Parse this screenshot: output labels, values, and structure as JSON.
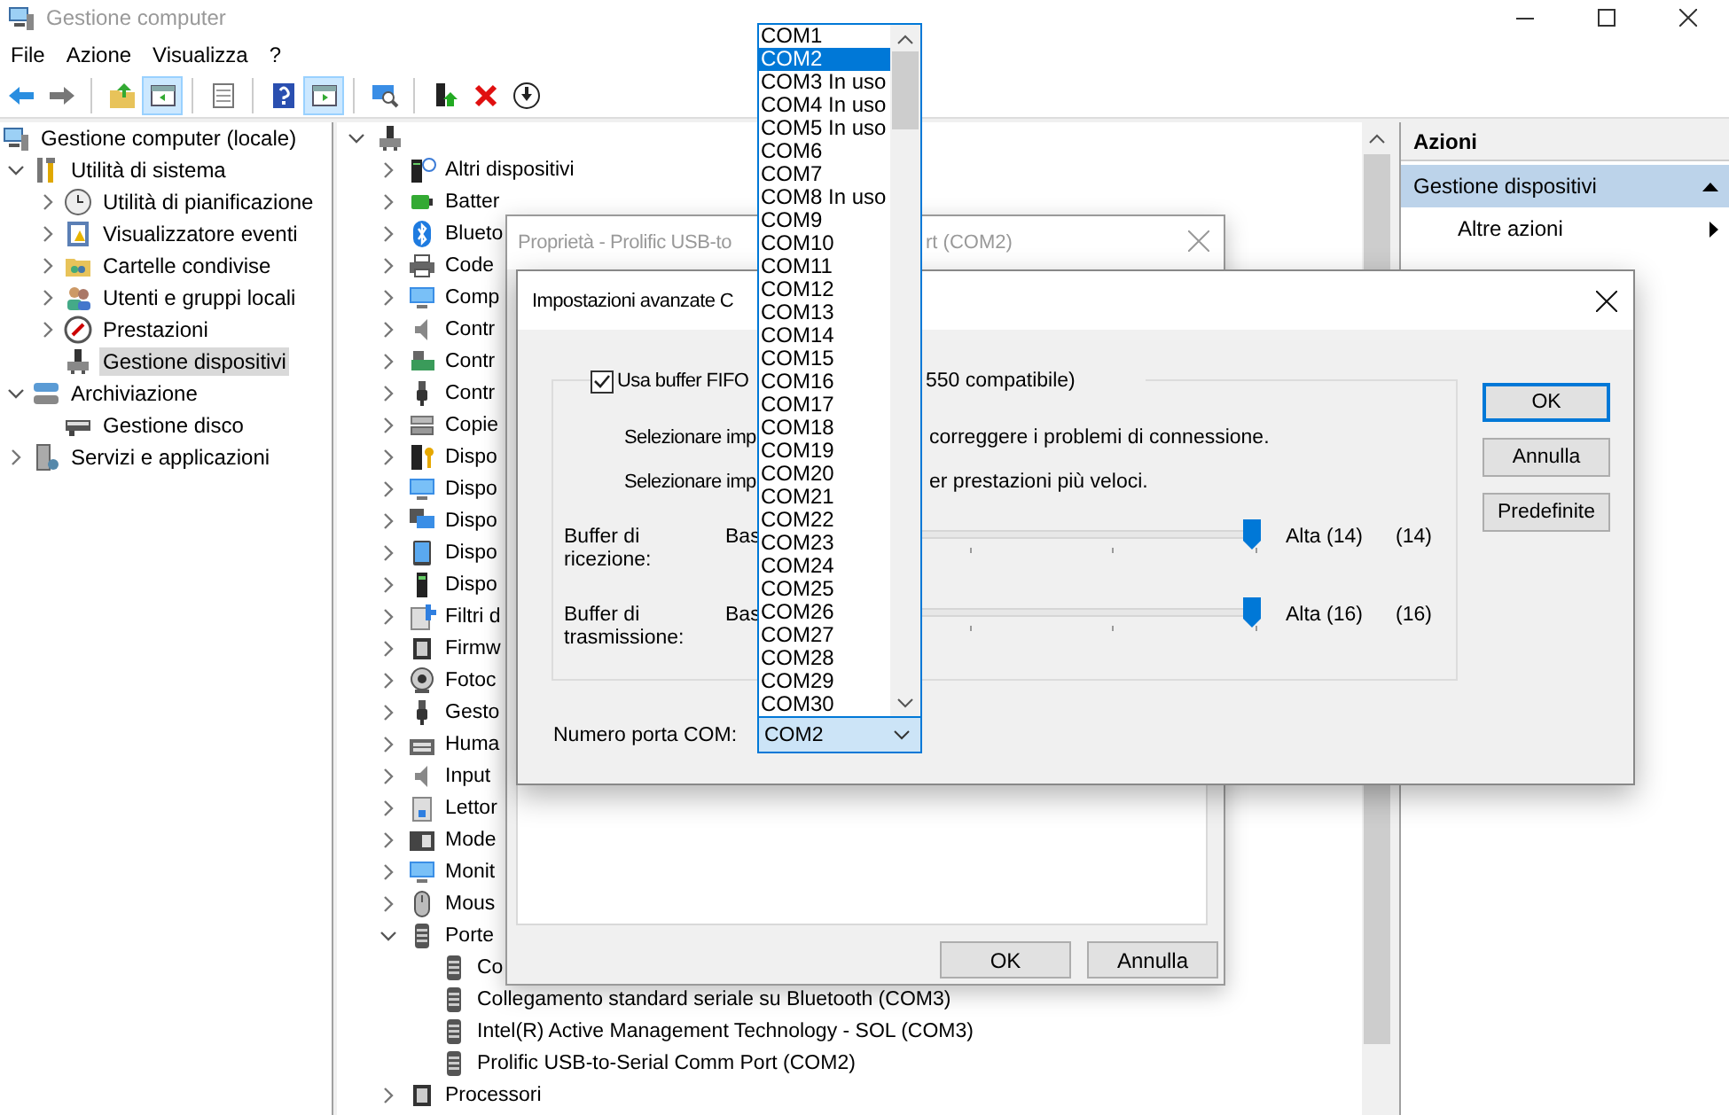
{
  "window": {
    "title": "Gestione computer",
    "menu": [
      "File",
      "Azione",
      "Visualizza",
      "?"
    ]
  },
  "toolbar": {
    "buttons": [
      {
        "pressed": false
      },
      {
        "pressed": false
      },
      {
        "pressed": false
      },
      {
        "pressed": true
      },
      {
        "pressed": false
      },
      {
        "pressed": false
      },
      {
        "pressed": true
      },
      {
        "pressed": false
      },
      {
        "pressed": false
      },
      {
        "pressed": false
      },
      {
        "pressed": false
      }
    ]
  },
  "navigation_tree": [
    {
      "label": "Gestione computer (locale)",
      "selected": false,
      "children": [
        {
          "label": "Utilità di sistema",
          "selected": false,
          "expanded": true,
          "children": [
            {
              "label": "Utilità di pianificazione",
              "selected": false,
              "expanded": false
            },
            {
              "label": "Visualizzatore eventi",
              "selected": false,
              "expanded": false
            },
            {
              "label": "Cartelle condivise",
              "selected": false,
              "expanded": false
            },
            {
              "label": "Utenti e gruppi locali",
              "selected": false,
              "expanded": false
            },
            {
              "label": "Prestazioni",
              "selected": false,
              "expanded": false
            },
            {
              "label": "Gestione dispositivi",
              "selected": true
            }
          ]
        },
        {
          "label": "Archiviazione",
          "selected": false,
          "expanded": true,
          "children": [
            {
              "label": "Gestione disco",
              "selected": false
            }
          ]
        },
        {
          "label": "Servizi e applicazioni",
          "selected": false,
          "expanded": false
        }
      ]
    }
  ],
  "device_tree": {
    "expanded": true,
    "children": [
      {
        "label": "Altri dispositivi",
        "selected": false,
        "expanded": false
      },
      {
        "label": "Batter",
        "selected": false,
        "expanded": false
      },
      {
        "label": "Blueto",
        "selected": false,
        "expanded": false
      },
      {
        "label": "Code",
        "selected": false,
        "expanded": false
      },
      {
        "label": "Comp",
        "selected": false,
        "expanded": false
      },
      {
        "label": "Contr",
        "selected": false,
        "expanded": false
      },
      {
        "label": "Contr",
        "selected": false,
        "expanded": false
      },
      {
        "label": "Contr",
        "selected": false,
        "expanded": false
      },
      {
        "label": "Copie",
        "selected": false,
        "expanded": false
      },
      {
        "label": "Dispo",
        "selected": false,
        "expanded": false
      },
      {
        "label": "Dispo",
        "selected": false,
        "expanded": false
      },
      {
        "label": "Dispo",
        "selected": false,
        "expanded": false
      },
      {
        "label": "Dispo",
        "selected": false,
        "expanded": false
      },
      {
        "label": "Dispo",
        "selected": false,
        "expanded": false
      },
      {
        "label": "Filtri d",
        "selected": false,
        "expanded": false
      },
      {
        "label": "Firmw",
        "selected": false,
        "expanded": false
      },
      {
        "label": "Fotoc",
        "selected": false,
        "expanded": false
      },
      {
        "label": "Gesto",
        "selected": false,
        "expanded": false
      },
      {
        "label": "Huma",
        "selected": false,
        "expanded": false
      },
      {
        "label": "Input",
        "selected": false,
        "expanded": false
      },
      {
        "label": "Lettor",
        "selected": false,
        "expanded": false
      },
      {
        "label": "Mode",
        "selected": false,
        "expanded": false
      },
      {
        "label": "Monit",
        "selected": false,
        "expanded": false
      },
      {
        "label": "Mous",
        "selected": false,
        "expanded": false
      },
      {
        "label": "Porte",
        "selected": false,
        "expanded": true,
        "children": [
          {
            "label": "Co",
            "selected": false
          },
          {
            "label": "Collegamento standard seriale su Bluetooth (COM3)",
            "selected": false
          },
          {
            "label": "Intel(R) Active Management Technology - SOL (COM3)",
            "selected": false
          },
          {
            "label": "Prolific USB-to-Serial Comm Port (COM2)",
            "selected": false
          }
        ]
      },
      {
        "label": "Processori",
        "selected": false,
        "expanded": false
      }
    ]
  },
  "actions_pane": {
    "title": "Azioni",
    "sections": [
      {
        "label": "Gestione dispositivi",
        "expanded": true,
        "items": [
          {
            "label": "Altre azioni",
            "submenu": true
          }
        ]
      }
    ]
  },
  "properties_dialog": {
    "title_parts": [
      "Proprietà - Prolific USB-to",
      "rt (COM2)"
    ],
    "buttons": [
      "OK",
      "Annulla"
    ]
  },
  "advanced_dialog": {
    "title": "Impostazioni avanzate C",
    "fifo": {
      "checked": true,
      "label_parts": [
        "Usa buffer FIFO",
        "550 compatibile)"
      ]
    },
    "hints": [
      {
        "parts": [
          "Selezionare imp",
          "correggere i problemi di connessione."
        ]
      },
      {
        "parts": [
          "Selezionare imp",
          "er prestazioni più veloci."
        ]
      }
    ],
    "sliders": [
      {
        "label": "Buffer di ricezione:",
        "low": "Bas",
        "level": 1,
        "high": "Alta (14)",
        "reading": "(14)"
      },
      {
        "label": "Buffer di trasmissione:",
        "low": "Bas",
        "level": 1,
        "high": "Alta (16)",
        "reading": "(16)"
      }
    ],
    "com_port": {
      "label": "Numero porta COM:",
      "value": "COM2",
      "options": [
        {
          "label": "COM1",
          "selected": false
        },
        {
          "label": "COM2",
          "selected": true
        },
        {
          "label": "COM3 In uso",
          "selected": false
        },
        {
          "label": "COM4 In uso",
          "selected": false
        },
        {
          "label": "COM5 In uso",
          "selected": false
        },
        {
          "label": "COM6",
          "selected": false
        },
        {
          "label": "COM7",
          "selected": false
        },
        {
          "label": "COM8 In uso",
          "selected": false
        },
        {
          "label": "COM9",
          "selected": false
        },
        {
          "label": "COM10",
          "selected": false
        },
        {
          "label": "COM11",
          "selected": false
        },
        {
          "label": "COM12",
          "selected": false
        },
        {
          "label": "COM13",
          "selected": false
        },
        {
          "label": "COM14",
          "selected": false
        },
        {
          "label": "COM15",
          "selected": false
        },
        {
          "label": "COM16",
          "selected": false
        },
        {
          "label": "COM17",
          "selected": false
        },
        {
          "label": "COM18",
          "selected": false
        },
        {
          "label": "COM19",
          "selected": false
        },
        {
          "label": "COM20",
          "selected": false
        },
        {
          "label": "COM21",
          "selected": false
        },
        {
          "label": "COM22",
          "selected": false
        },
        {
          "label": "COM23",
          "selected": false
        },
        {
          "label": "COM24",
          "selected": false
        },
        {
          "label": "COM25",
          "selected": false
        },
        {
          "label": "COM26",
          "selected": false
        },
        {
          "label": "COM27",
          "selected": false
        },
        {
          "label": "COM28",
          "selected": false
        },
        {
          "label": "COM29",
          "selected": false
        },
        {
          "label": "COM30",
          "selected": false
        }
      ]
    },
    "buttons": [
      {
        "label": "OK",
        "default": true
      },
      {
        "label": "Annulla",
        "default": false
      },
      {
        "label": "Predefinite",
        "default": false
      }
    ]
  }
}
